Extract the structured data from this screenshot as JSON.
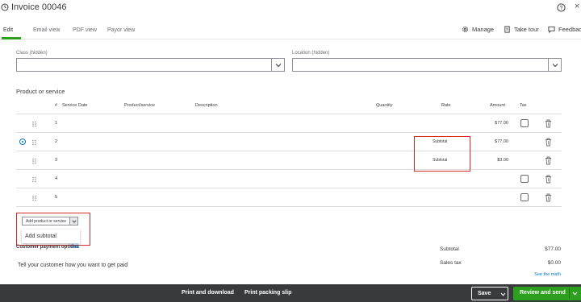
{
  "header": {
    "title": "Invoice 00046",
    "close_glyph": "×"
  },
  "tabs": [
    {
      "label": "Edit"
    },
    {
      "label": "Email view"
    },
    {
      "label": "PDF view"
    },
    {
      "label": "Payor view"
    }
  ],
  "toolbar": {
    "manage": "Manage",
    "take_tour": "Take tour",
    "feedback": "Feedbac"
  },
  "fields": {
    "class_label": "Class (hidden)",
    "location_label": "Location (hidden)"
  },
  "section_title": "Product or service",
  "table": {
    "headers": [
      "#",
      "Service Date",
      "Product/service",
      "Description",
      "Quantity",
      "Rate",
      "Amount",
      "Tax"
    ],
    "rows": [
      {
        "num": "1",
        "rate_text": "",
        "amount": "$77.00"
      },
      {
        "num": "2",
        "rate_text": "Subtotal",
        "amount": "$77.00"
      },
      {
        "num": "3",
        "rate_text": "Subtotal",
        "amount": "$3.00"
      },
      {
        "num": "4",
        "rate_text": "",
        "amount": ""
      },
      {
        "num": "5",
        "rate_text": "",
        "amount": ""
      }
    ]
  },
  "add_button_label": "Add product or service",
  "add_menu_item": "Add subtotal",
  "payment": {
    "label": "Customer payment options",
    "edit": "Edit",
    "tell": "Tell your customer how you want to get paid"
  },
  "summary": {
    "subtotal_label": "Subtotal",
    "subtotal_value": "$77.00",
    "sales_tax_label": "Sales tax",
    "sales_tax_value": "$0.00",
    "see_math": "See the math"
  },
  "footer": {
    "print_download": "Print and download",
    "print_packing": "Print packing slip",
    "save": "Save",
    "review_send": "Review and send"
  },
  "colors": {
    "accent_green": "#2ca01c",
    "link_blue": "#0077c5",
    "highlight_red": "#d62b2b",
    "footer_bg": "#393a3d"
  }
}
